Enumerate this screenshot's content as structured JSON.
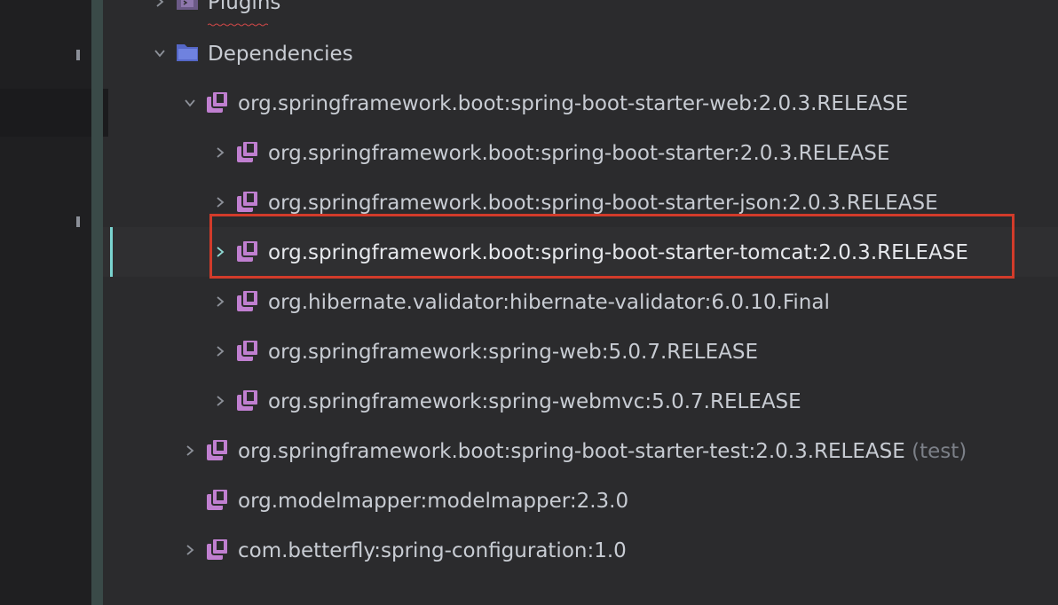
{
  "tree": {
    "plugins": {
      "label": "Plugins",
      "icon": "plugin-folder-icon"
    },
    "dependencies": {
      "label": "Dependencies",
      "icon": "folder-icon"
    },
    "items": [
      {
        "label": "org.springframework.boot:spring-boot-starter-web:2.0.3.RELEASE",
        "expanded": true
      },
      {
        "label": "org.springframework.boot:spring-boot-starter:2.0.3.RELEASE"
      },
      {
        "label": "org.springframework.boot:spring-boot-starter-json:2.0.3.RELEASE"
      },
      {
        "label": "org.springframework.boot:spring-boot-starter-tomcat:2.0.3.RELEASE",
        "selected": true
      },
      {
        "label": "org.hibernate.validator:hibernate-validator:6.0.10.Final"
      },
      {
        "label": "org.springframework:spring-web:5.0.7.RELEASE"
      },
      {
        "label": "org.springframework:spring-webmvc:5.0.7.RELEASE"
      },
      {
        "label": "org.springframework.boot:spring-boot-starter-test:2.0.3.RELEASE",
        "suffix": "(test)"
      },
      {
        "label": "org.modelmapper:modelmapper:2.3.0"
      },
      {
        "label": "com.betterfly:spring-configuration:1.0"
      }
    ]
  },
  "colors": {
    "library_icon": "#c07fd0",
    "folder_icon": "#6a7fd6",
    "highlight_border": "#d23b2a",
    "selection_gutter": "#7ad3cf"
  }
}
